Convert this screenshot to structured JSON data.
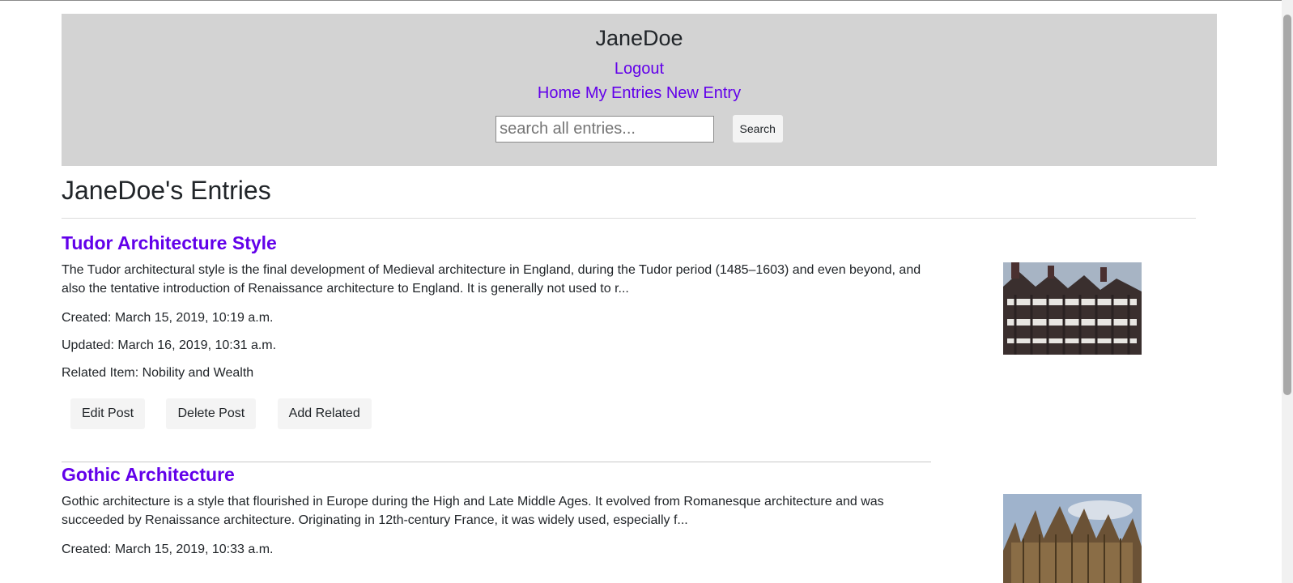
{
  "header": {
    "username": "JaneDoe",
    "logout": "Logout",
    "nav": [
      "Home",
      "My Entries",
      "New Entry"
    ],
    "search_placeholder": "search all entries...",
    "search_button": "Search"
  },
  "page_title": "JaneDoe's Entries",
  "entries": [
    {
      "title": "Tudor Architecture Style",
      "excerpt": "The Tudor architectural style is the final development of Medieval architecture in England, during the Tudor period (1485–1603) and even beyond, and also the tentative introduction of Renaissance architecture to England. It is generally not used to r...",
      "created": "Created: March 15, 2019, 10:19 a.m.",
      "updated": "Updated: March 16, 2019, 10:31 a.m.",
      "related": "Related Item: Nobility and Wealth",
      "buttons": [
        "Edit Post",
        "Delete Post",
        "Add Related"
      ]
    },
    {
      "title": "Gothic Architecture",
      "excerpt": "Gothic architecture is a style that flourished in Europe during the High and Late Middle Ages. It evolved from Romanesque architecture and was succeeded by Renaissance architecture. Originating in 12th-century France, it was widely used, especially f...",
      "created": "Created: March 15, 2019, 10:33 a.m."
    }
  ]
}
